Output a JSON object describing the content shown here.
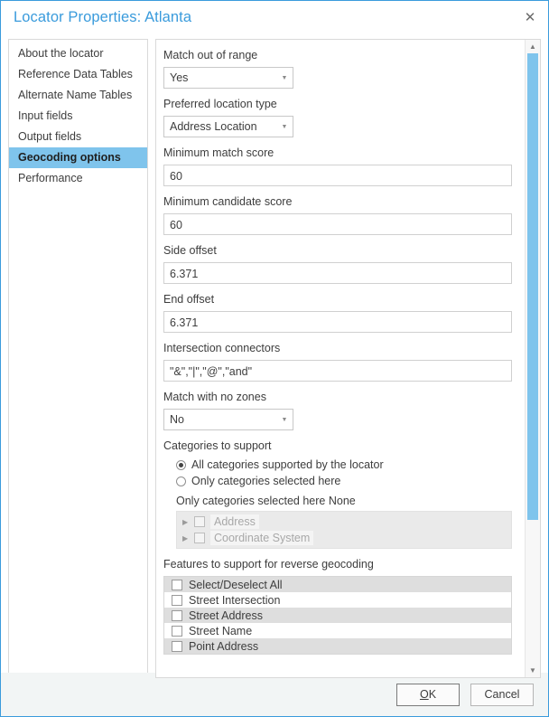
{
  "window": {
    "title": "Locator Properties: Atlanta",
    "close_icon": "close-icon",
    "accent_color": "#3a9bdc",
    "highlight_color": "#7fc4ec"
  },
  "sidebar": {
    "items": [
      {
        "label": "About the locator",
        "selected": false
      },
      {
        "label": "Reference Data Tables",
        "selected": false
      },
      {
        "label": "Alternate Name Tables",
        "selected": false
      },
      {
        "label": "Input fields",
        "selected": false
      },
      {
        "label": "Output fields",
        "selected": false
      },
      {
        "label": "Geocoding options",
        "selected": true
      },
      {
        "label": "Performance",
        "selected": false
      }
    ]
  },
  "form": {
    "match_out_of_range": {
      "label": "Match out of range",
      "value": "Yes"
    },
    "preferred_location_type": {
      "label": "Preferred location type",
      "value": "Address Location"
    },
    "minimum_match_score": {
      "label": "Minimum match score",
      "value": "60"
    },
    "minimum_candidate_score": {
      "label": "Minimum candidate score",
      "value": "60"
    },
    "side_offset": {
      "label": "Side offset",
      "value": "6.371"
    },
    "end_offset": {
      "label": "End offset",
      "value": "6.371"
    },
    "intersection_connectors": {
      "label": "Intersection connectors",
      "value": "\"&\",\"|\",\"@\",\"and\""
    },
    "match_with_no_zones": {
      "label": "Match with no zones",
      "value": "No"
    }
  },
  "categories": {
    "label": "Categories to support",
    "options": [
      {
        "label": "All categories supported by the locator",
        "checked": true
      },
      {
        "label": "Only categories selected here",
        "checked": false
      }
    ],
    "selection_note": "Only categories selected here None",
    "tree": [
      {
        "label": "Address",
        "checked": false,
        "expander": "expand-triangle-icon"
      },
      {
        "label": "Coordinate System",
        "checked": false,
        "expander": "expand-triangle-icon"
      }
    ]
  },
  "reverse_geocoding": {
    "label": "Features to support for reverse geocoding",
    "rows": [
      {
        "label": "Select/Deselect All",
        "checked": false
      },
      {
        "label": "Street Intersection",
        "checked": false
      },
      {
        "label": "Street Address",
        "checked": false
      },
      {
        "label": "Street Name",
        "checked": false
      },
      {
        "label": "Point Address",
        "checked": false
      }
    ]
  },
  "scrollbar": {
    "up_arrow": "scroll-up-icon",
    "down_arrow": "scroll-down-icon"
  },
  "footer": {
    "ok_prefix": "O",
    "ok_suffix": "K",
    "cancel_label": "Cancel"
  }
}
